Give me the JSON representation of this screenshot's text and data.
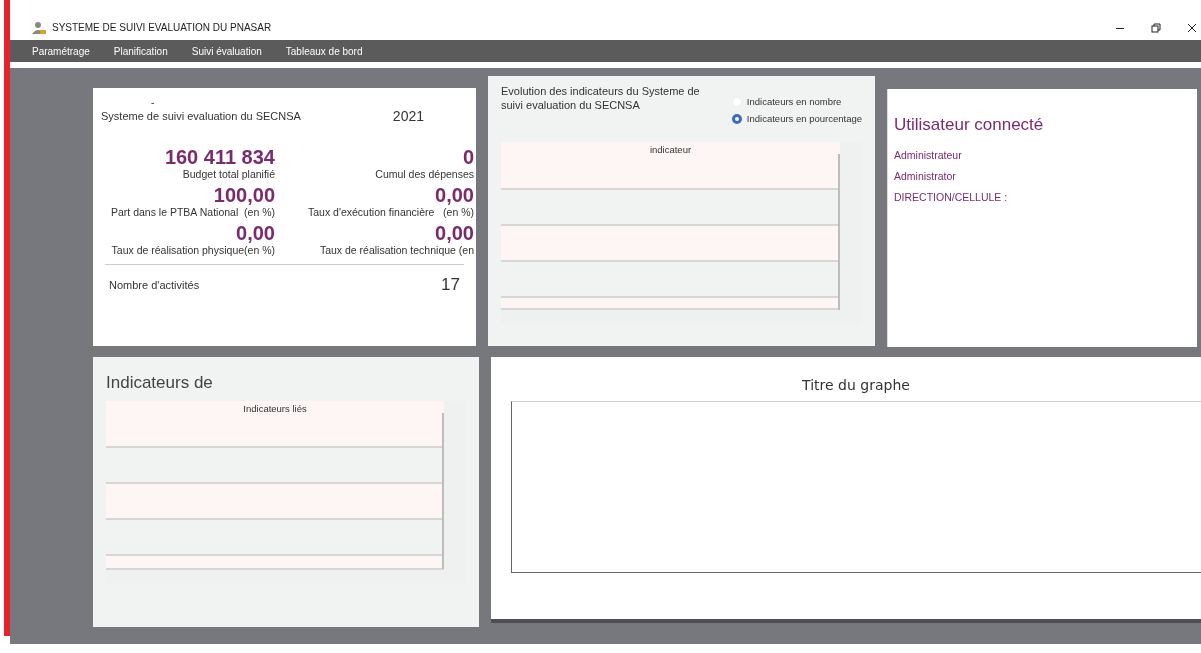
{
  "window": {
    "title": "SYSTEME DE SUIVI EVALUATION DU PNASAR"
  },
  "menu": [
    "Paramétrage",
    "Planification",
    "Suivi évaluation",
    "Tableaux de bord"
  ],
  "kpi_card": {
    "dash": "-",
    "title": "Systeme de suivi evaluation du SECNSA",
    "year": "2021",
    "metrics": [
      {
        "value": "160 411 834",
        "label": "Budget total planifié"
      },
      {
        "value": "0",
        "label": "Cumul des dépenses"
      },
      {
        "value": "100,00",
        "label": "Part dans le PTBA National  (en %)"
      },
      {
        "value": "0,00",
        "label": "Taux d'exécution financière   (en %)"
      },
      {
        "value": "0,00",
        "label": "Taux de réalisation physique(en %)"
      },
      {
        "value": "0,00",
        "label": "Taux de réalisation technique (en"
      }
    ],
    "activities": {
      "label": "Nombre d'activités",
      "value": "17"
    }
  },
  "evolution_panel": {
    "title": "Evolution des indicateurs du Systeme de suivi evaluation du SECNSA",
    "options": [
      {
        "label": "Indicateurs en nombre",
        "selected": false
      },
      {
        "label": "Indicateurs en pourcentage",
        "selected": true
      }
    ],
    "table": {
      "column": "indicateur"
    }
  },
  "user_panel": {
    "title": "Utilisateur connecté",
    "lines": [
      "Administrateur",
      "Administrator",
      "DIRECTION/CELLULE :"
    ]
  },
  "indicators_panel": {
    "title": "Indicateurs de",
    "table": {
      "column": "Indicateurs liés"
    }
  },
  "graph_panel": {
    "title": "Titre du graphe"
  }
}
